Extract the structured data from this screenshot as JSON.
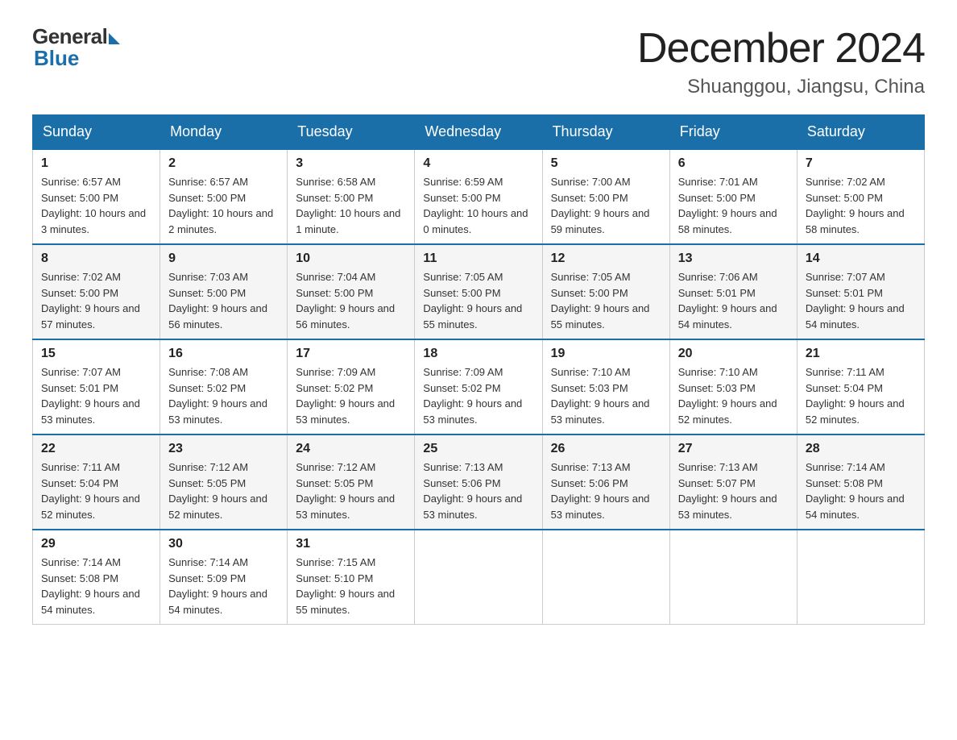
{
  "logo": {
    "general": "General",
    "blue": "Blue"
  },
  "title": "December 2024",
  "subtitle": "Shuanggou, Jiangsu, China",
  "headers": [
    "Sunday",
    "Monday",
    "Tuesday",
    "Wednesday",
    "Thursday",
    "Friday",
    "Saturday"
  ],
  "weeks": [
    [
      {
        "day": "1",
        "sunrise": "Sunrise: 6:57 AM",
        "sunset": "Sunset: 5:00 PM",
        "daylight": "Daylight: 10 hours and 3 minutes."
      },
      {
        "day": "2",
        "sunrise": "Sunrise: 6:57 AM",
        "sunset": "Sunset: 5:00 PM",
        "daylight": "Daylight: 10 hours and 2 minutes."
      },
      {
        "day": "3",
        "sunrise": "Sunrise: 6:58 AM",
        "sunset": "Sunset: 5:00 PM",
        "daylight": "Daylight: 10 hours and 1 minute."
      },
      {
        "day": "4",
        "sunrise": "Sunrise: 6:59 AM",
        "sunset": "Sunset: 5:00 PM",
        "daylight": "Daylight: 10 hours and 0 minutes."
      },
      {
        "day": "5",
        "sunrise": "Sunrise: 7:00 AM",
        "sunset": "Sunset: 5:00 PM",
        "daylight": "Daylight: 9 hours and 59 minutes."
      },
      {
        "day": "6",
        "sunrise": "Sunrise: 7:01 AM",
        "sunset": "Sunset: 5:00 PM",
        "daylight": "Daylight: 9 hours and 58 minutes."
      },
      {
        "day": "7",
        "sunrise": "Sunrise: 7:02 AM",
        "sunset": "Sunset: 5:00 PM",
        "daylight": "Daylight: 9 hours and 58 minutes."
      }
    ],
    [
      {
        "day": "8",
        "sunrise": "Sunrise: 7:02 AM",
        "sunset": "Sunset: 5:00 PM",
        "daylight": "Daylight: 9 hours and 57 minutes."
      },
      {
        "day": "9",
        "sunrise": "Sunrise: 7:03 AM",
        "sunset": "Sunset: 5:00 PM",
        "daylight": "Daylight: 9 hours and 56 minutes."
      },
      {
        "day": "10",
        "sunrise": "Sunrise: 7:04 AM",
        "sunset": "Sunset: 5:00 PM",
        "daylight": "Daylight: 9 hours and 56 minutes."
      },
      {
        "day": "11",
        "sunrise": "Sunrise: 7:05 AM",
        "sunset": "Sunset: 5:00 PM",
        "daylight": "Daylight: 9 hours and 55 minutes."
      },
      {
        "day": "12",
        "sunrise": "Sunrise: 7:05 AM",
        "sunset": "Sunset: 5:00 PM",
        "daylight": "Daylight: 9 hours and 55 minutes."
      },
      {
        "day": "13",
        "sunrise": "Sunrise: 7:06 AM",
        "sunset": "Sunset: 5:01 PM",
        "daylight": "Daylight: 9 hours and 54 minutes."
      },
      {
        "day": "14",
        "sunrise": "Sunrise: 7:07 AM",
        "sunset": "Sunset: 5:01 PM",
        "daylight": "Daylight: 9 hours and 54 minutes."
      }
    ],
    [
      {
        "day": "15",
        "sunrise": "Sunrise: 7:07 AM",
        "sunset": "Sunset: 5:01 PM",
        "daylight": "Daylight: 9 hours and 53 minutes."
      },
      {
        "day": "16",
        "sunrise": "Sunrise: 7:08 AM",
        "sunset": "Sunset: 5:02 PM",
        "daylight": "Daylight: 9 hours and 53 minutes."
      },
      {
        "day": "17",
        "sunrise": "Sunrise: 7:09 AM",
        "sunset": "Sunset: 5:02 PM",
        "daylight": "Daylight: 9 hours and 53 minutes."
      },
      {
        "day": "18",
        "sunrise": "Sunrise: 7:09 AM",
        "sunset": "Sunset: 5:02 PM",
        "daylight": "Daylight: 9 hours and 53 minutes."
      },
      {
        "day": "19",
        "sunrise": "Sunrise: 7:10 AM",
        "sunset": "Sunset: 5:03 PM",
        "daylight": "Daylight: 9 hours and 53 minutes."
      },
      {
        "day": "20",
        "sunrise": "Sunrise: 7:10 AM",
        "sunset": "Sunset: 5:03 PM",
        "daylight": "Daylight: 9 hours and 52 minutes."
      },
      {
        "day": "21",
        "sunrise": "Sunrise: 7:11 AM",
        "sunset": "Sunset: 5:04 PM",
        "daylight": "Daylight: 9 hours and 52 minutes."
      }
    ],
    [
      {
        "day": "22",
        "sunrise": "Sunrise: 7:11 AM",
        "sunset": "Sunset: 5:04 PM",
        "daylight": "Daylight: 9 hours and 52 minutes."
      },
      {
        "day": "23",
        "sunrise": "Sunrise: 7:12 AM",
        "sunset": "Sunset: 5:05 PM",
        "daylight": "Daylight: 9 hours and 52 minutes."
      },
      {
        "day": "24",
        "sunrise": "Sunrise: 7:12 AM",
        "sunset": "Sunset: 5:05 PM",
        "daylight": "Daylight: 9 hours and 53 minutes."
      },
      {
        "day": "25",
        "sunrise": "Sunrise: 7:13 AM",
        "sunset": "Sunset: 5:06 PM",
        "daylight": "Daylight: 9 hours and 53 minutes."
      },
      {
        "day": "26",
        "sunrise": "Sunrise: 7:13 AM",
        "sunset": "Sunset: 5:06 PM",
        "daylight": "Daylight: 9 hours and 53 minutes."
      },
      {
        "day": "27",
        "sunrise": "Sunrise: 7:13 AM",
        "sunset": "Sunset: 5:07 PM",
        "daylight": "Daylight: 9 hours and 53 minutes."
      },
      {
        "day": "28",
        "sunrise": "Sunrise: 7:14 AM",
        "sunset": "Sunset: 5:08 PM",
        "daylight": "Daylight: 9 hours and 54 minutes."
      }
    ],
    [
      {
        "day": "29",
        "sunrise": "Sunrise: 7:14 AM",
        "sunset": "Sunset: 5:08 PM",
        "daylight": "Daylight: 9 hours and 54 minutes."
      },
      {
        "day": "30",
        "sunrise": "Sunrise: 7:14 AM",
        "sunset": "Sunset: 5:09 PM",
        "daylight": "Daylight: 9 hours and 54 minutes."
      },
      {
        "day": "31",
        "sunrise": "Sunrise: 7:15 AM",
        "sunset": "Sunset: 5:10 PM",
        "daylight": "Daylight: 9 hours and 55 minutes."
      },
      {
        "day": "",
        "sunrise": "",
        "sunset": "",
        "daylight": ""
      },
      {
        "day": "",
        "sunrise": "",
        "sunset": "",
        "daylight": ""
      },
      {
        "day": "",
        "sunrise": "",
        "sunset": "",
        "daylight": ""
      },
      {
        "day": "",
        "sunrise": "",
        "sunset": "",
        "daylight": ""
      }
    ]
  ]
}
